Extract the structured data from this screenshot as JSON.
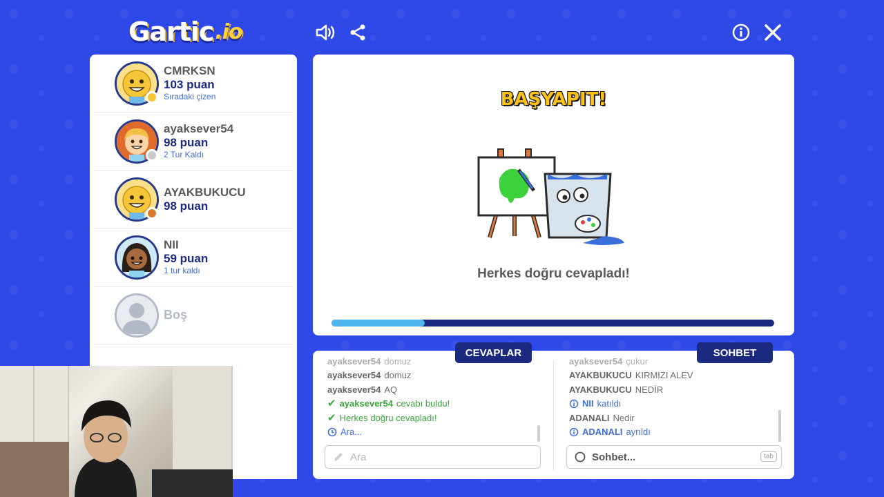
{
  "app": {
    "logo_text": "Gartic",
    "logo_suffix": ".io"
  },
  "top_icons": [
    "speaker-icon",
    "share-icon",
    "info-icon",
    "close-icon"
  ],
  "players": [
    {
      "name": "CMRKSN",
      "score": "103 puan",
      "status": "Sıradaki çizen",
      "dot_color": "#f7c531",
      "avatar": "smiley-yellow"
    },
    {
      "name": "ayaksever54",
      "score": "98 puan",
      "status": "2 Tur Kaldı",
      "dot_color": "#c9c9c9",
      "avatar": "kid-orange"
    },
    {
      "name": "AYAKBUKUCU",
      "score": "98 puan",
      "status": "",
      "dot_color": "#d87b2b",
      "avatar": "smiley-yellow"
    },
    {
      "name": "NII",
      "score": "59 puan",
      "status": "1 tur kaldı",
      "dot_color": "",
      "avatar": "kid-braids"
    },
    {
      "name": "Boş",
      "score": "",
      "status": "",
      "dot_color": "",
      "avatar": "empty"
    }
  ],
  "canvas": {
    "headline": "BAŞYAPIT!",
    "message": "Herkes doğru cevapladı!",
    "progress": 0.21
  },
  "answers": {
    "tab_label": "CEVAPLAR",
    "entries": [
      {
        "user": "ayaksever54",
        "text": "domuz",
        "type": "guess",
        "faded": true
      },
      {
        "user": "ayaksever54",
        "text": "domuz",
        "type": "guess"
      },
      {
        "user": "ayaksever54",
        "text": "AQ",
        "type": "guess"
      },
      {
        "user": "ayaksever54",
        "text": "cevabı buldu!",
        "type": "correct"
      },
      {
        "user": "",
        "text": "Herkes doğru cevapladı!",
        "type": "correct"
      },
      {
        "user": "",
        "text": "Ara...",
        "type": "system"
      }
    ],
    "placeholder": "Ara"
  },
  "chat": {
    "tab_label": "SOHBET",
    "entries": [
      {
        "user": "ayaksever54",
        "text": "çukur",
        "type": "msg",
        "faded": true
      },
      {
        "user": "AYAKBUKUCU",
        "text": "KIRMIZI ALEV",
        "type": "msg"
      },
      {
        "user": "AYAKBUKUCU",
        "text": "NEDİR",
        "type": "msg"
      },
      {
        "user": "NII",
        "text": "katıldı",
        "type": "info"
      },
      {
        "user": "ADANALI",
        "text": "Nedir",
        "type": "msg"
      },
      {
        "user": "ADANALI",
        "text": "ayrıldı",
        "type": "info"
      }
    ],
    "placeholder": "Sohbet...",
    "shortcut": "tab"
  },
  "colors": {
    "background": "#2f48e8",
    "navy": "#1b2a7e",
    "progress": "#4fb6f0",
    "headline": "#ffc21a"
  }
}
